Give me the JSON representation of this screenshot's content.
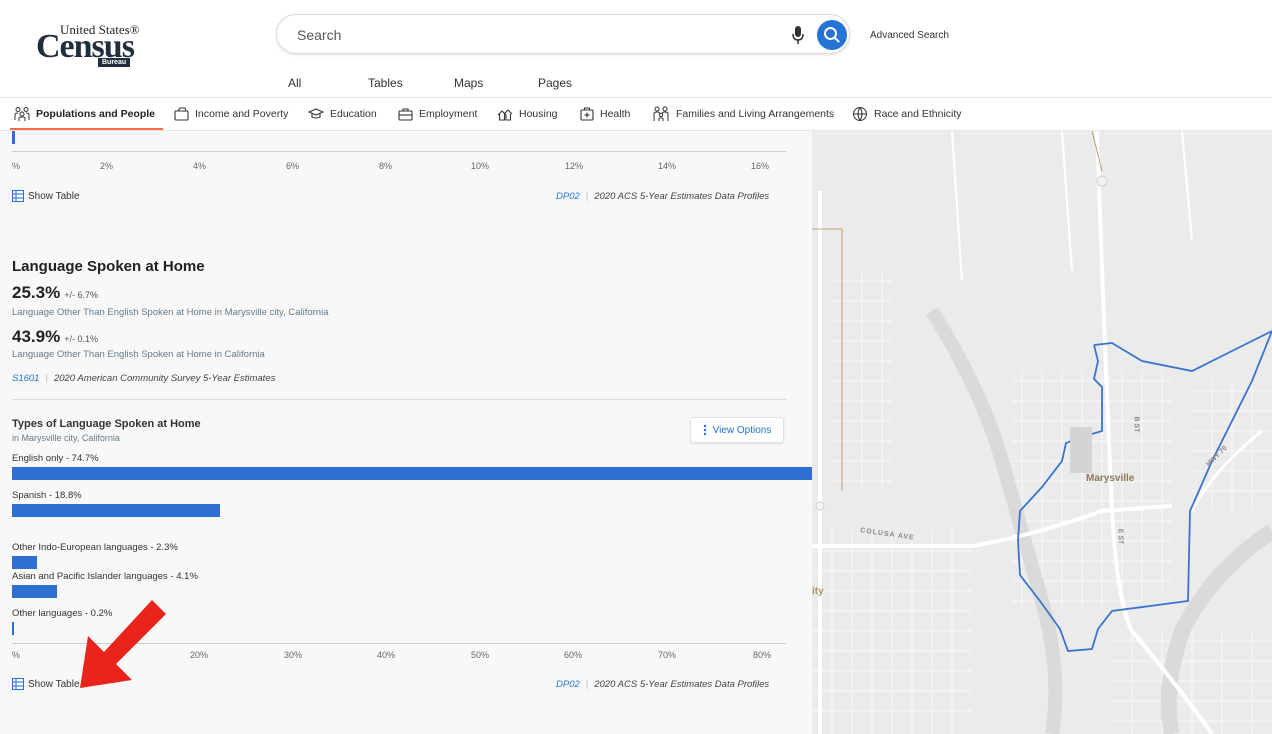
{
  "header": {
    "logo_line1": "United States®",
    "logo_line2": "Census",
    "logo_line3": "Bureau",
    "search_placeholder": "Search",
    "advanced_search": "Advanced Search",
    "sub_tabs": [
      "All",
      "Tables",
      "Maps",
      "Pages"
    ]
  },
  "topics": [
    {
      "label": "Populations and People",
      "icon": "people-icon",
      "active": true
    },
    {
      "label": "Income and Poverty",
      "icon": "wallet-icon"
    },
    {
      "label": "Education",
      "icon": "graduation-cap-icon"
    },
    {
      "label": "Employment",
      "icon": "briefcase-icon"
    },
    {
      "label": "Housing",
      "icon": "house-icon"
    },
    {
      "label": "Health",
      "icon": "first-aid-icon"
    },
    {
      "label": "Families and Living Arrangements",
      "icon": "family-icon"
    },
    {
      "label": "Race and Ethnicity",
      "icon": "globe-people-icon"
    }
  ],
  "top_chart": {
    "ticks": [
      "%",
      "2%",
      "4%",
      "6%",
      "8%",
      "10%",
      "12%",
      "14%",
      "16%"
    ],
    "show_table": "Show Table",
    "source_code": "DP02",
    "source_text": "2020 ACS 5-Year Estimates Data Profiles"
  },
  "language_section": {
    "title": "Language Spoken at Home",
    "stat1_value": "25.3%",
    "stat1_moe": "+/- 6.7%",
    "stat1_desc": "Language Other Than English Spoken at Home in Marysville city, California",
    "stat2_value": "43.9%",
    "stat2_moe": "+/- 0.1%",
    "stat2_desc": "Language Other Than English Spoken at Home in California",
    "source_code": "S1601",
    "source_text": "2020 American Community Survey 5-Year Estimates"
  },
  "language_chart": {
    "title": "Types of Language Spoken at Home",
    "subtitle": "in Marysville city, California",
    "view_options": "View Options",
    "show_table": "Show Table",
    "source_code": "DP02",
    "source_text": "2020 ACS 5-Year Estimates Data Profiles"
  },
  "chart_data": {
    "type": "bar",
    "orientation": "horizontal",
    "categories": [
      "English only",
      "Spanish",
      "Other Indo-European languages",
      "Asian and Pacific Islander languages",
      "Other languages"
    ],
    "values": [
      74.7,
      18.8,
      2.3,
      4.1,
      0.2
    ],
    "labels": [
      "English only - 74.7%",
      "Spanish - 18.8%",
      "Other Indo-European languages - 2.3%",
      "Asian and Pacific Islander languages - 4.1%",
      "Other languages - 0.2%"
    ],
    "xticks": [
      "%",
      "20%",
      "30%",
      "40%",
      "50%",
      "60%",
      "70%",
      "80%"
    ],
    "xlim": [
      10,
      80
    ],
    "color": "#2e6fd1"
  },
  "map": {
    "place_label": "Marysville",
    "street_colusa": "COLUSA AVE",
    "street_bst": "B ST",
    "street_est": "E ST",
    "street_hwy": "HWY 70",
    "edge_label": "ity",
    "boundary_color": "#3a74d0"
  },
  "colors": {
    "accent": "#2573d4",
    "tab_underline": "#f46b45",
    "arrow": "#e8241b"
  }
}
